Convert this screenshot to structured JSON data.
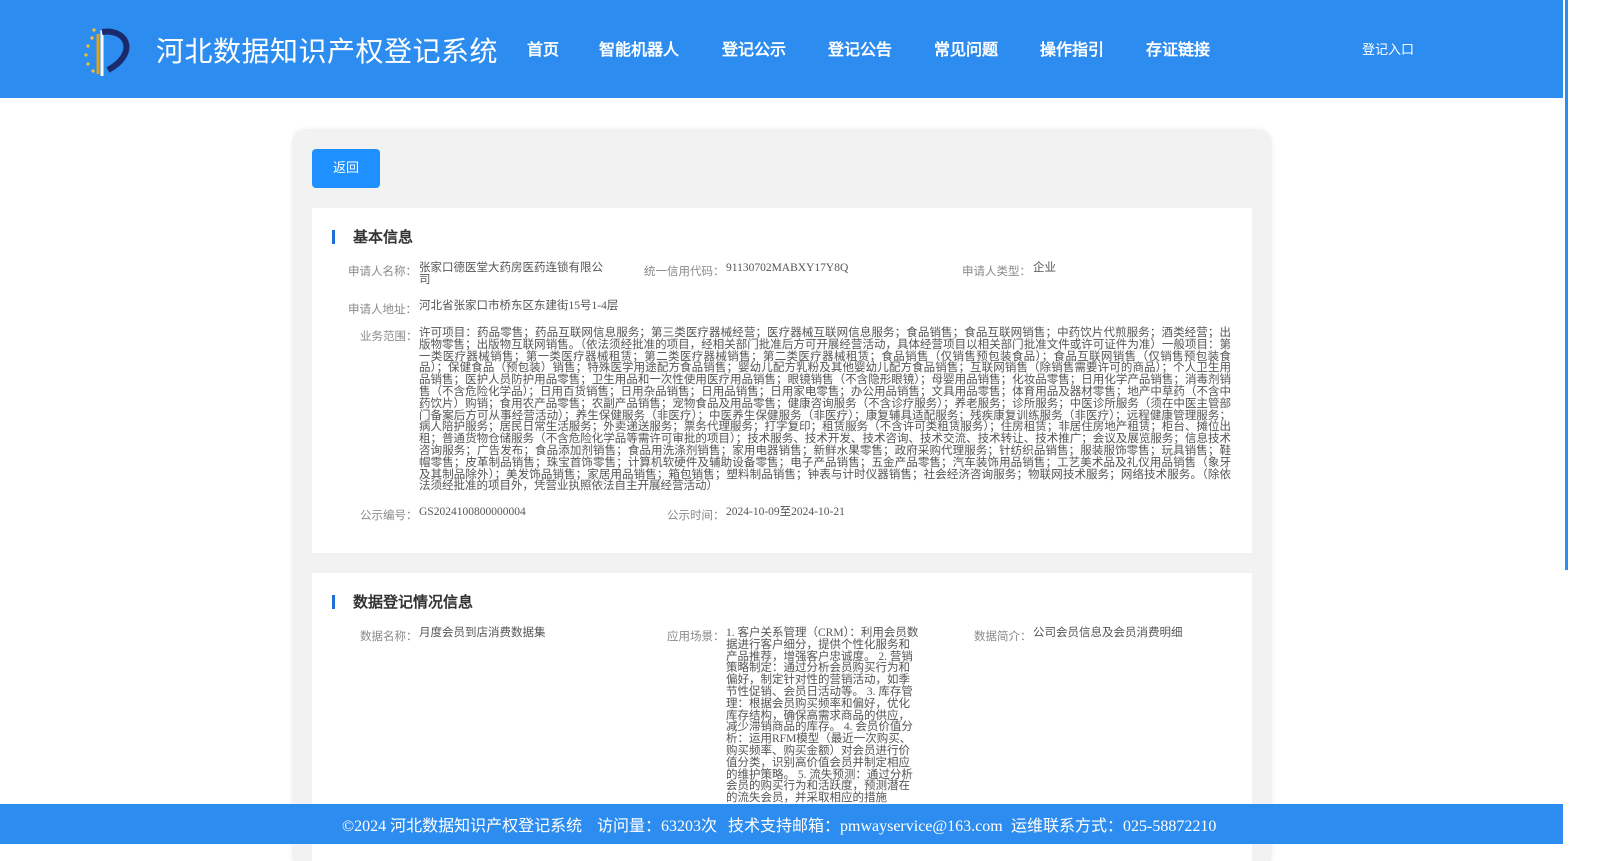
{
  "header": {
    "title": "河北数据知识产权登记系统",
    "nav": [
      "首页",
      "智能机器人",
      "登记公示",
      "登记公告",
      "常见问题",
      "操作指引",
      "存证链接"
    ],
    "login": "登记入口"
  },
  "actions": {
    "back": "返回"
  },
  "basic": {
    "title": "基本信息",
    "applicant_name_label": "申请人名称：",
    "applicant_name": "张家口德医堂大药房医药连锁有限公司",
    "credit_code_label": "统一信用代码：",
    "credit_code": "91130702MABXY17Y8Q",
    "applicant_type_label": "申请人类型：",
    "applicant_type": "企业",
    "address_label": "申请人地址：",
    "address": "河北省张家口市桥东区东建街15号1-4层",
    "scope_label": "业务范围：",
    "scope": "许可项目：药品零售；药品互联网信息服务；第三类医疗器械经营；医疗器械互联网信息服务；食品销售；食品互联网销售；中药饮片代煎服务；酒类经营；出版物零售；出版物互联网销售。（依法须经批准的项目，经相关部门批准后方可开展经营活动，具体经营项目以相关部门批准文件或许可证件为准）一般项目：第一类医疗器械销售；第一类医疗器械租赁；第二类医疗器械销售；第二类医疗器械租赁；食品销售（仅销售预包装食品）；食品互联网销售（仅销售预包装食品）；保健食品（预包装）销售；特殊医学用途配方食品销售；婴幼儿配方乳粉及其他婴幼儿配方食品销售；互联网销售（除销售需要许可的商品）；个人卫生用品销售；医护人员防护用品零售；卫生用品和一次性使用医疗用品销售；眼镜销售（不含隐形眼镜）；母婴用品销售；化妆品零售；日用化学产品销售；消毒剂销售（不含危险化学品）；日用百货销售；日用杂品销售；日用品销售；日用家电零售；办公用品销售；文具用品零售；体育用品及器材零售；地产中草药（不含中药饮片）购销；食用农产品零售；农副产品销售；宠物食品及用品零售；健康咨询服务（不含诊疗服务）；养老服务；诊所服务；中医诊所服务（须在中医主管部门备案后方可从事经营活动）；养生保健服务（非医疗）；中医养生保健服务（非医疗）；康复辅具适配服务；残疾康复训练服务（非医疗）；远程健康管理服务；病人陪护服务；居民日常生活服务；外卖递送服务；票务代理服务；打字复印；租赁服务（不含许可类租赁服务）；住房租赁；非居住房地产租赁；柜台、摊位出租；普通货物仓储服务（不含危险化学品等需许可审批的项目）；技术服务、技术开发、技术咨询、技术交流、技术转让、技术推广；会议及展览服务；信息技术咨询服务；广告发布；食品添加剂销售；食品用洗涤剂销售；家用电器销售；新鲜水果零售；政府采购代理服务；针纺织品销售；服装服饰零售；玩具销售；鞋帽零售；皮革制品销售；珠宝首饰零售；计算机软硬件及辅助设备零售；电子产品销售；五金产品零售；汽车装饰用品销售；工艺美术品及礼仪用品销售（象牙及其制品除外）；美发饰品销售；家居用品销售；箱包销售；塑料制品销售；钟表与计时仪器销售；社会经济咨询服务；物联网技术服务；网络技术服务。（除依法须经批准的项目外，凭营业执照依法自主开展经营活动）",
    "notice_no_label": "公示编号：",
    "notice_no": "GS2024100800000004",
    "notice_time_label": "公示时间：",
    "notice_time": "2024-10-09至2024-10-21"
  },
  "registration": {
    "title": "数据登记情况信息",
    "data_name_label": "数据名称：",
    "data_name": "月度会员到店消费数据集",
    "scene_label": "应用场景：",
    "scene": "1. 客户关系管理（CRM）：利用会员数据进行客户细分，提供个性化服务和产品推荐，增强客户忠诚度。 2. 营销策略制定：通过分析会员购买行为和偏好，制定针对性的营销活动，如季节性促销、会员日活动等。 3. 库存管理：根据会员购买频率和偏好，优化库存结构，确保高需求商品的供应，减少滞销商品的库存。 4. 会员价值分析：运用RFM模型（最近一次购买、购买频率、购买金额）对会员进行价值分类，识别高价值会员并制定相应的维护策略。 5. 流失预测：通过分析会员的购买行为和活跃度，预测潜在的流失会员，并采取相应的措施",
    "summary_label": "数据简介：",
    "summary": "公司会员信息及会员消费明细"
  },
  "footer": {
    "copyright": "©2024 河北数据知识产权登记系统",
    "visits": "访问量：63203次",
    "email": "技术支持邮箱：pmwayservice@163.com",
    "phone": "运维联系方式：025-58872210"
  }
}
